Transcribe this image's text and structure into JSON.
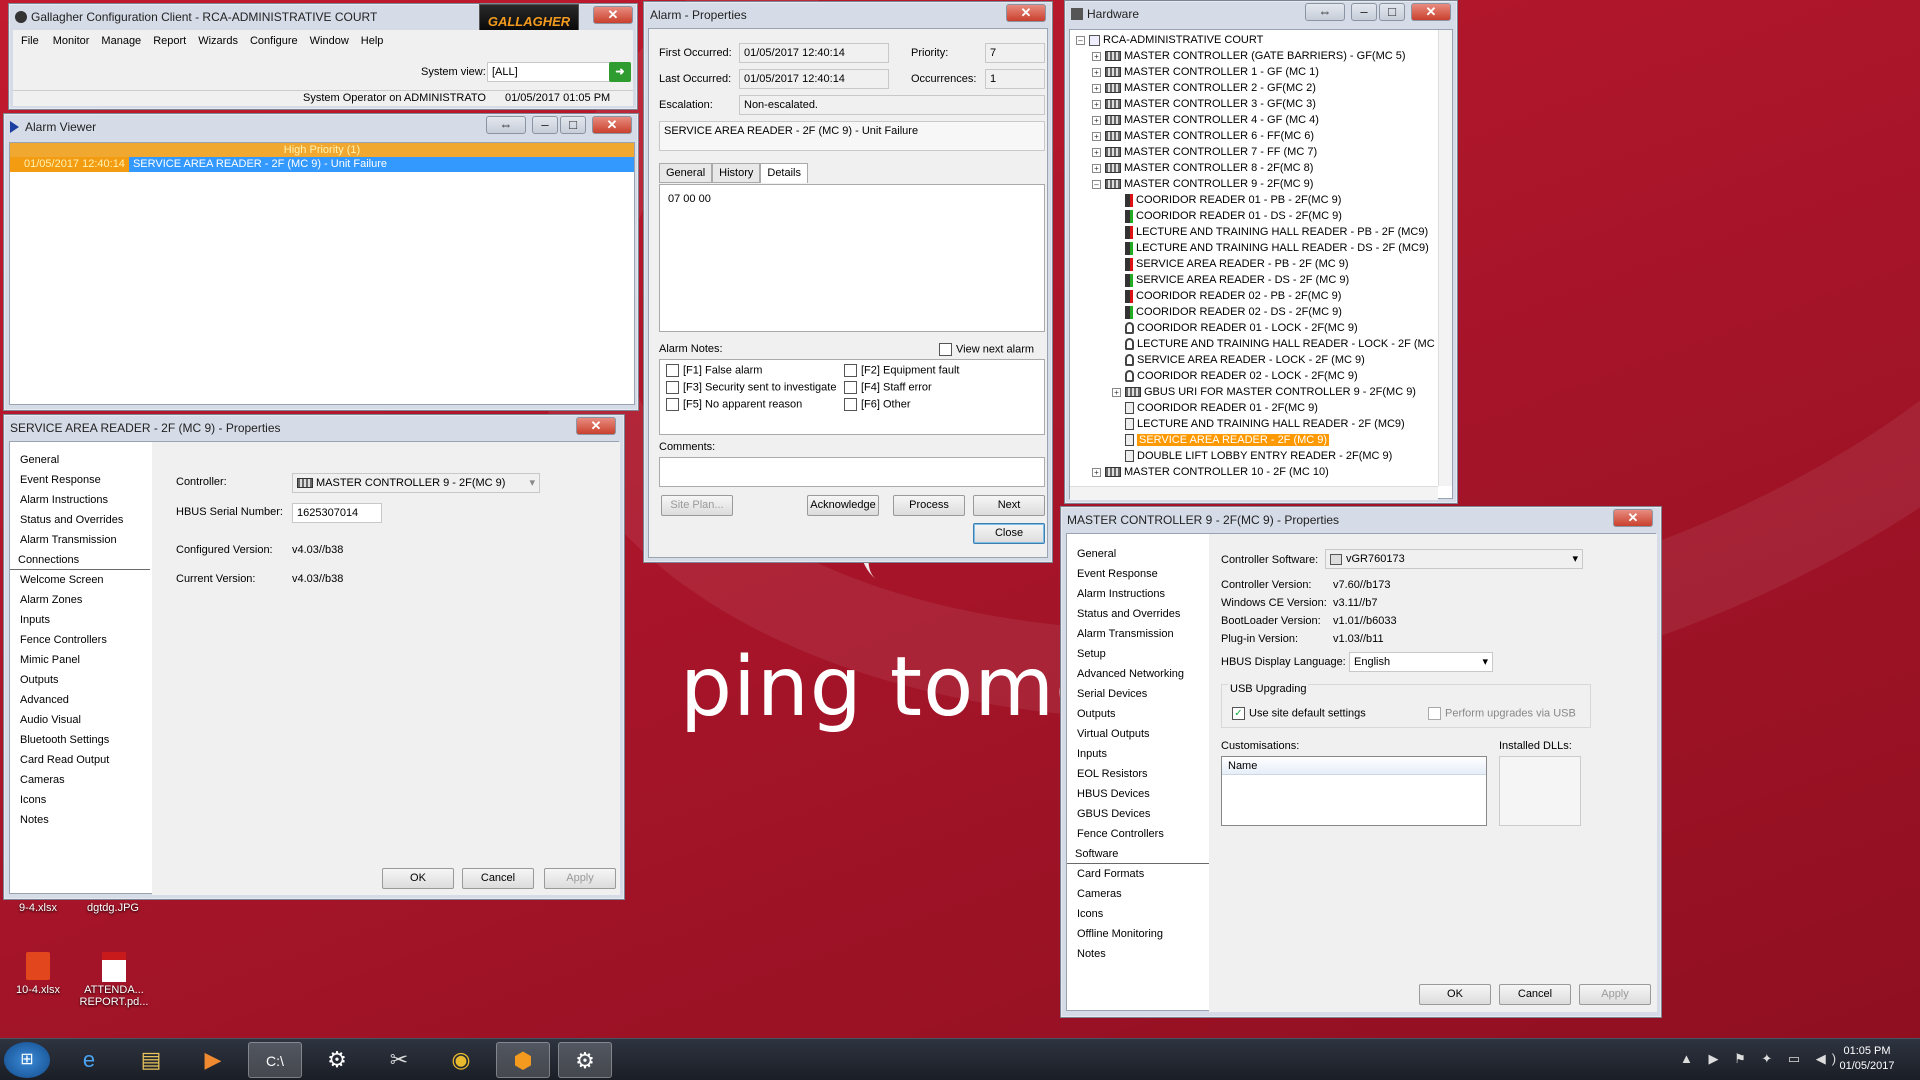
{
  "desktop": {
    "bg_text": "ping tomorro",
    "icons": [
      {
        "label": "9-4.xlsx"
      },
      {
        "label": "dgtdg.JPG"
      },
      {
        "label": "10-4.xlsx"
      },
      {
        "label": "ATTENDA... REPORT.pd..."
      }
    ]
  },
  "client": {
    "title": "Gallagher Configuration Client - RCA-ADMINISTRATIVE COURT",
    "logo": "GALLAGHER",
    "menu": [
      "File",
      "Monitor",
      "Manage",
      "Report",
      "Wizards",
      "Configure",
      "Window",
      "Help"
    ],
    "system_view_label": "System view:",
    "system_view_value": "[ALL]",
    "status": "System Operator on ADMINISTRATO",
    "datetime": "01/05/2017 01:05 PM"
  },
  "alarm_viewer": {
    "title": "Alarm Viewer",
    "group": "High Priority (1)",
    "row_time": "01/05/2017 12:40:14",
    "row_text": "SERVICE AREA READER - 2F (MC 9) - Unit Failure"
  },
  "reader_props": {
    "title": "SERVICE AREA READER - 2F (MC 9) - Properties",
    "nav": [
      "General",
      "Event Response",
      "Alarm Instructions",
      "Status and Overrides",
      "Alarm Transmission",
      "Connections",
      "Welcome Screen",
      "Alarm Zones",
      "Inputs",
      "Fence Controllers",
      "Mimic Panel",
      "Outputs",
      "Advanced",
      "Audio Visual",
      "Bluetooth Settings",
      "Card Read Output",
      "Cameras",
      "Icons",
      "Notes"
    ],
    "selected": "Connections",
    "controller_label": "Controller:",
    "controller_value": "MASTER CONTROLLER 9 - 2F(MC 9)",
    "serial_label": "HBUS Serial Number:",
    "serial_value": "1625307014",
    "config_label": "Configured Version:",
    "config_value": "v4.03//b38",
    "current_label": "Current Version:",
    "current_value": "v4.03//b38",
    "ok": "OK",
    "cancel": "Cancel",
    "apply": "Apply"
  },
  "alarm_props": {
    "title": "Alarm - Properties",
    "first_label": "First Occurred:",
    "first_value": "01/05/2017 12:40:14",
    "priority_label": "Priority:",
    "priority_value": "7",
    "last_label": "Last Occurred:",
    "last_value": "01/05/2017 12:40:14",
    "occ_label": "Occurrences:",
    "occ_value": "1",
    "esc_label": "Escalation:",
    "esc_value": "Non-escalated.",
    "message": "SERVICE AREA READER - 2F (MC 9) - Unit Failure",
    "tabs": [
      "General",
      "History",
      "Details"
    ],
    "details": "07 00 00",
    "notes_label": "Alarm Notes:",
    "view_next": "View next alarm",
    "notes": [
      "[F1] False alarm",
      "[F2] Equipment fault",
      "[F3] Security sent to investigate",
      "[F4] Staff error",
      "[F5] No apparent reason",
      "[F6] Other"
    ],
    "comments_label": "Comments:",
    "site_plan": "Site Plan...",
    "acknowledge": "Acknowledge",
    "process": "Process",
    "next": "Next",
    "close": "Close"
  },
  "hardware": {
    "title": "Hardware",
    "root": "RCA-ADMINISTRATIVE COURT",
    "items": [
      {
        "t": "MASTER CONTROLLER (GATE BARRIERS) - GF(MC 5)",
        "k": "ctl",
        "l": 0
      },
      {
        "t": "MASTER CONTROLLER 1 - GF (MC 1)",
        "k": "ctl",
        "l": 0
      },
      {
        "t": "MASTER CONTROLLER 2 - GF(MC 2)",
        "k": "ctl",
        "l": 0
      },
      {
        "t": "MASTER CONTROLLER 3 - GF(MC 3)",
        "k": "ctl",
        "l": 0
      },
      {
        "t": "MASTER CONTROLLER 4 - GF (MC 4)",
        "k": "ctl",
        "l": 0
      },
      {
        "t": "MASTER CONTROLLER 6 - FF(MC 6)",
        "k": "ctl",
        "l": 0
      },
      {
        "t": "MASTER CONTROLLER 7 - FF (MC 7)",
        "k": "ctl",
        "l": 0
      },
      {
        "t": "MASTER CONTROLLER 8 - 2F(MC 8)",
        "k": "ctl",
        "l": 0
      },
      {
        "t": "MASTER CONTROLLER 9 - 2F(MC 9)",
        "k": "ctl",
        "l": 0
      },
      {
        "t": "COORIDOR READER 01 - PB - 2F(MC 9)",
        "k": "rdrr",
        "l": 1
      },
      {
        "t": "COORIDOR READER 01 - DS - 2F(MC 9)",
        "k": "rdr",
        "l": 1
      },
      {
        "t": "LECTURE AND TRAINING HALL READER - PB - 2F (MC9)",
        "k": "rdrr",
        "l": 1
      },
      {
        "t": "LECTURE AND TRAINING HALL READER - DS - 2F (MC9)",
        "k": "rdr",
        "l": 1
      },
      {
        "t": "SERVICE AREA READER  - PB -  2F (MC 9)",
        "k": "rdrr",
        "l": 1
      },
      {
        "t": "SERVICE AREA READER  - DS -  2F (MC 9)",
        "k": "rdr",
        "l": 1
      },
      {
        "t": "COORIDOR READER 02 - PB - 2F(MC 9)",
        "k": "rdrr",
        "l": 1
      },
      {
        "t": "COORIDOR READER 02 - DS - 2F(MC 9)",
        "k": "rdr",
        "l": 1
      },
      {
        "t": "COORIDOR READER 01 - LOCK - 2F(MC 9)",
        "k": "lock",
        "l": 1
      },
      {
        "t": "LECTURE AND TRAINING HALL READER - LOCK - 2F (MC",
        "k": "lock",
        "l": 1
      },
      {
        "t": "SERVICE AREA READER - LOCK - 2F (MC 9)",
        "k": "lock",
        "l": 1
      },
      {
        "t": "COORIDOR READER 02 - LOCK - 2F(MC 9)",
        "k": "lock",
        "l": 1
      },
      {
        "t": "GBUS URI FOR MASTER CONTROLLER 9 - 2F(MC 9)",
        "k": "ctl",
        "l": 1
      },
      {
        "t": "COORIDOR READER 01 - 2F(MC 9)",
        "k": "dev",
        "l": 1
      },
      {
        "t": "LECTURE AND TRAINING HALL READER - 2F (MC9)",
        "k": "dev",
        "l": 1
      },
      {
        "t": "SERVICE AREA READER - 2F (MC 9)",
        "k": "dev",
        "l": 1,
        "sel": true
      },
      {
        "t": "DOUBLE LIFT LOBBY ENTRY READER - 2F(MC 9)",
        "k": "dev",
        "l": 1
      },
      {
        "t": "MASTER CONTROLLER 10 - 2F (MC 10)",
        "k": "ctl",
        "l": 0
      }
    ]
  },
  "mc9_props": {
    "title": "MASTER CONTROLLER 9 - 2F(MC 9) - Properties",
    "nav": [
      "General",
      "Event Response",
      "Alarm Instructions",
      "Status and Overrides",
      "Alarm Transmission",
      "Setup",
      "Advanced Networking",
      "Serial Devices",
      "Outputs",
      "Virtual Outputs",
      "Inputs",
      "EOL Resistors",
      "HBUS Devices",
      "GBUS Devices",
      "Fence Controllers",
      "Software",
      "Card Formats",
      "Cameras",
      "Icons",
      "Offline Monitoring",
      "Notes"
    ],
    "selected": "Software",
    "sw_label": "Controller Software:",
    "sw_value": "vGR760173",
    "rows": [
      {
        "k": "Controller Version:",
        "v": "v7.60//b173"
      },
      {
        "k": "Windows CE Version:",
        "v": "v3.11//b7"
      },
      {
        "k": "BootLoader Version:",
        "v": "v1.01//b6033"
      },
      {
        "k": "Plug-in Version:",
        "v": "v1.03//b11"
      }
    ],
    "lang_label": "HBUS Display Language:",
    "lang_value": "English",
    "usb_group": "USB Upgrading",
    "usb_default": "Use site default settings",
    "usb_perform": "Perform upgrades via USB",
    "cust_label": "Customisations:",
    "dll_label": "Installed DLLs:",
    "name_col": "Name",
    "ok": "OK",
    "cancel": "Cancel",
    "apply": "Apply"
  },
  "taskbar": {
    "time": "01:05 PM",
    "date": "01/05/2017"
  },
  "colors": {
    "title_bar": "#d6dce7",
    "selection": "#3399ff",
    "highlight_orange": "#ff9900"
  }
}
